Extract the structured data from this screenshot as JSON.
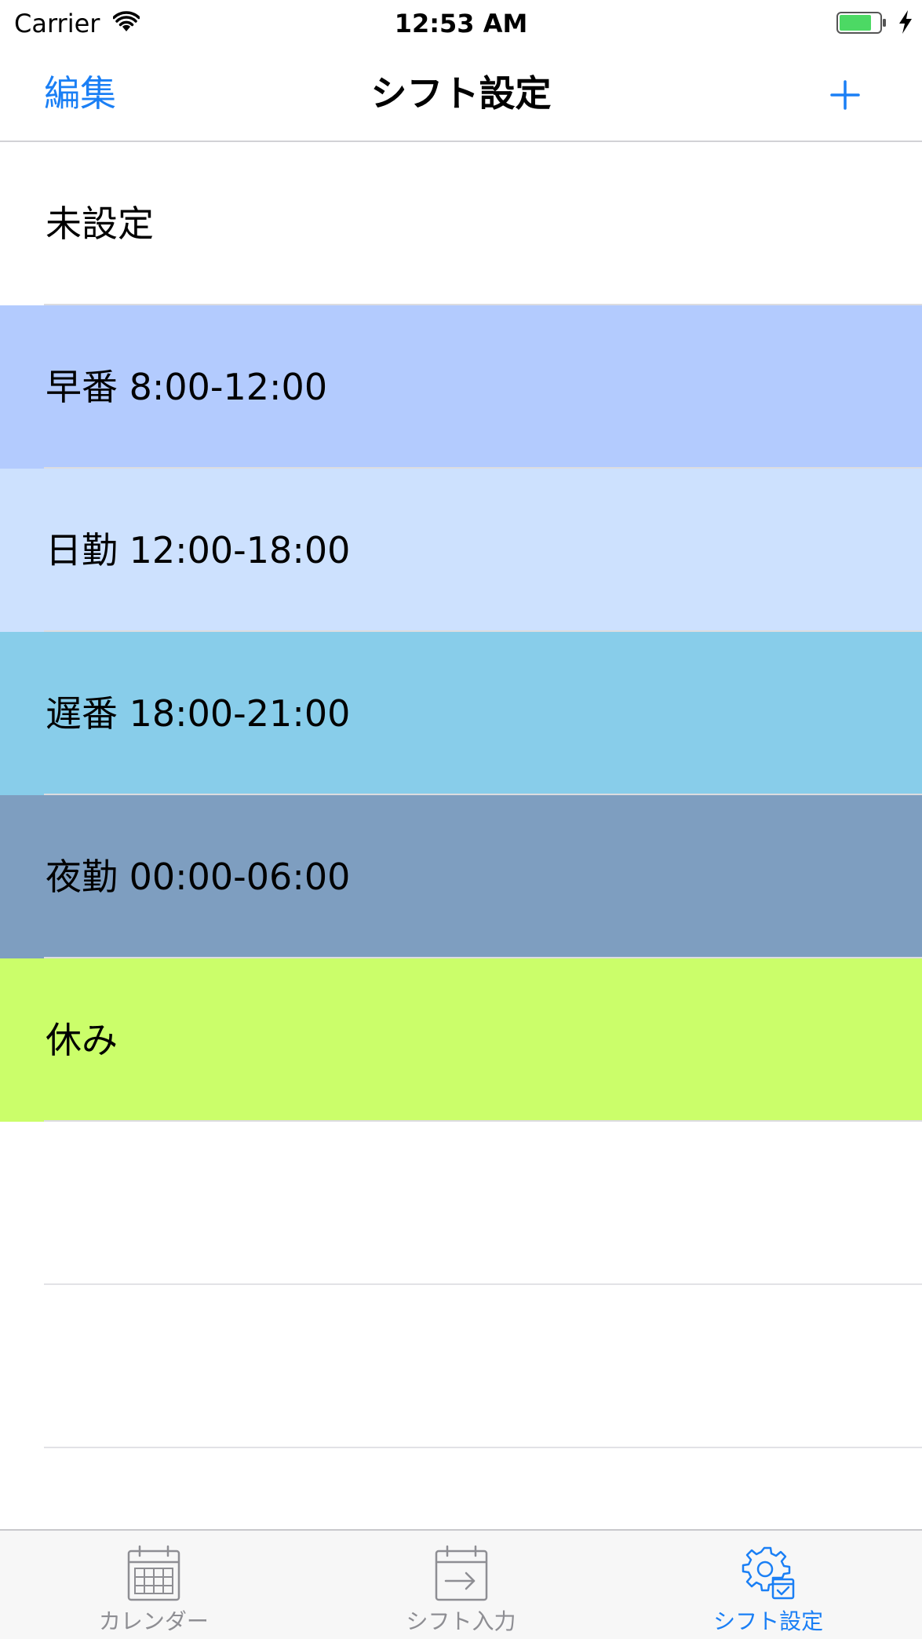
{
  "status_bar": {
    "carrier": "Carrier",
    "time": "12:53 AM",
    "battery_color": "#4cd964"
  },
  "nav": {
    "edit_label": "編集",
    "title": "シフト設定",
    "add_icon": "plus-icon",
    "tint_color": "#1a7ff5"
  },
  "shifts": [
    {
      "label": "未設定",
      "color": "#ffffff"
    },
    {
      "label": "早番 8:00-12:00",
      "color": "#b3cbfe"
    },
    {
      "label": "日勤 12:00-18:00",
      "color": "#cde1fe"
    },
    {
      "label": "遅番 18:00-21:00",
      "color": "#88cdea"
    },
    {
      "label": "夜勤 00:00-06:00",
      "color": "#7e9ec0"
    },
    {
      "label": "休み",
      "color": "#cbfe6a"
    }
  ],
  "tabs": [
    {
      "label": "カレンダー",
      "icon": "calendar-icon",
      "active": false
    },
    {
      "label": "シフト入力",
      "icon": "calendar-input-icon",
      "active": false
    },
    {
      "label": "シフト設定",
      "icon": "gear-settings-icon",
      "active": true
    }
  ]
}
